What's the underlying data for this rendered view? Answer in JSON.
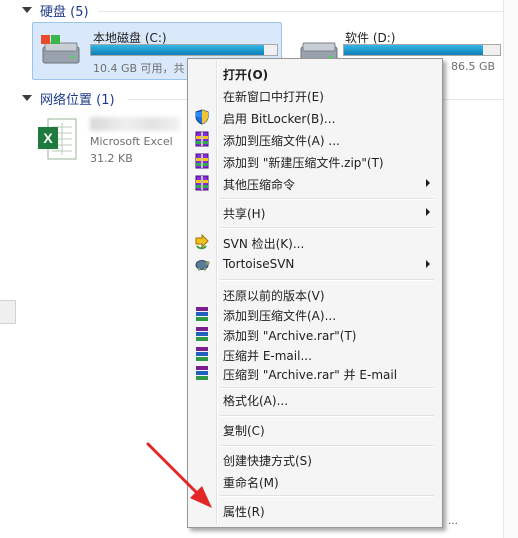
{
  "sections": {
    "hard_disks": {
      "title": "硬盘 (5)"
    },
    "network": {
      "title": "网络位置 (1)"
    }
  },
  "drives": [
    {
      "name": "本地磁盘 (C:)",
      "info": "10.4 GB 可用，共",
      "usage": 0.93
    },
    {
      "name": "软件 (D:)",
      "info": "86.5 GB",
      "usage": 0.89
    }
  ],
  "file": {
    "type": "Microsoft Excel",
    "size": "31.2 KB"
  },
  "status_text": "…",
  "menu": {
    "items": [
      {
        "label": "打开(O)"
      },
      {
        "label": "在新窗口中打开(E)"
      },
      {
        "label": "启用 BitLocker(B)..."
      },
      {
        "label": "添加到压缩文件(A) ..."
      },
      {
        "label": "添加到 \"新建压缩文件.zip\"(T)"
      },
      {
        "label": "其他压缩命令"
      },
      {
        "label": "共享(H)"
      },
      {
        "label": "SVN 检出(K)..."
      },
      {
        "label": "TortoiseSVN"
      },
      {
        "label": "还原以前的版本(V)"
      },
      {
        "label": "添加到压缩文件(A)..."
      },
      {
        "label": "添加到 \"Archive.rar\"(T)"
      },
      {
        "label": "压缩并 E-mail..."
      },
      {
        "label": "压缩到 \"Archive.rar\" 并 E-mail"
      },
      {
        "label": "格式化(A)..."
      },
      {
        "label": "复制(C)"
      },
      {
        "label": "创建快捷方式(S)"
      },
      {
        "label": "重命名(M)"
      },
      {
        "label": "属性(R)"
      }
    ]
  },
  "colors": {
    "accent_arrow": "#e32626",
    "selection": "#d9e9fb",
    "bar": "#1a9bd1"
  },
  "icons": [
    "drive-icon",
    "excel-icon",
    "shield-icon",
    "winrar-icon",
    "svn-checkout-icon",
    "tortoisesvn-icon",
    "rar-stack-icon"
  ]
}
